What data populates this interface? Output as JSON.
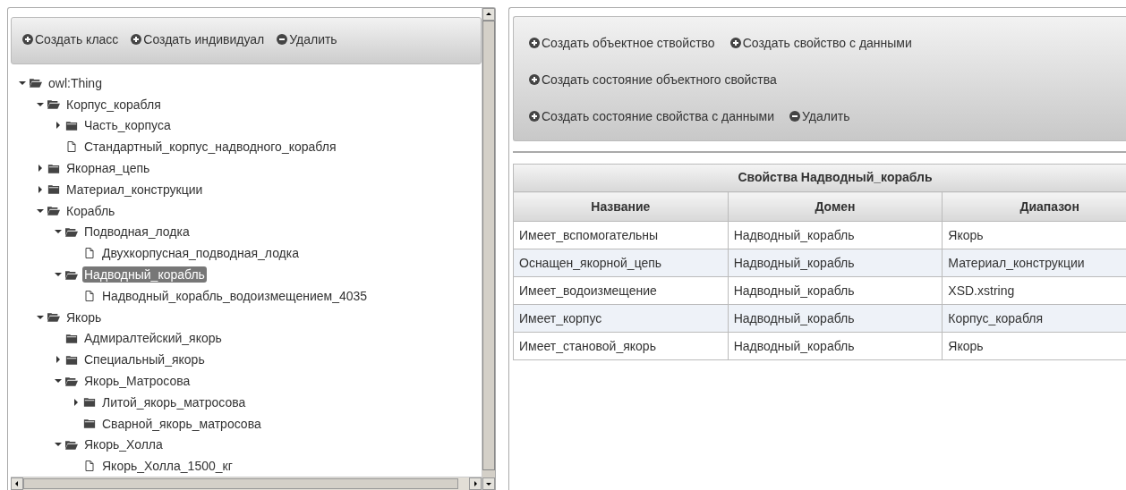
{
  "class_toolbar": [
    {
      "kind": "add",
      "label": "Создать класс"
    },
    {
      "kind": "add",
      "label": "Создать индивидуал"
    },
    {
      "kind": "remove",
      "label": "Удалить"
    }
  ],
  "tree": [
    {
      "label": "owl:Thing",
      "kind": "class",
      "expanded": true,
      "selected": false,
      "children": [
        {
          "label": "Корпус_корабля",
          "kind": "class",
          "expanded": true,
          "selected": false,
          "children": [
            {
              "label": "Часть_корпуса",
              "kind": "class",
              "expanded": false,
              "selected": false
            },
            {
              "label": "Стандартный_корпус_надводного_корабля",
              "kind": "individual",
              "selected": false
            }
          ]
        },
        {
          "label": "Якорная_цепь",
          "kind": "class",
          "expanded": false,
          "selected": false
        },
        {
          "label": "Материал_конструкции",
          "kind": "class",
          "expanded": false,
          "selected": false
        },
        {
          "label": "Корабль",
          "kind": "class",
          "expanded": true,
          "selected": false,
          "children": [
            {
              "label": "Подводная_лодка",
              "kind": "class",
              "expanded": true,
              "selected": false,
              "children": [
                {
                  "label": "Двухкорпусная_подводная_лодка",
                  "kind": "individual",
                  "selected": false
                }
              ]
            },
            {
              "label": "Надводный_корабль",
              "kind": "class",
              "expanded": true,
              "selected": true,
              "children": [
                {
                  "label": "Надводный_корабль_водоизмещением_4035",
                  "kind": "individual",
                  "selected": false
                }
              ]
            }
          ]
        },
        {
          "label": "Якорь",
          "kind": "class",
          "expanded": true,
          "selected": false,
          "children": [
            {
              "label": "Адмиралтейский_якорь",
              "kind": "class",
              "selected": false
            },
            {
              "label": "Специальный_якорь",
              "kind": "class",
              "expanded": false,
              "selected": false
            },
            {
              "label": "Якорь_Матросова",
              "kind": "class",
              "expanded": true,
              "selected": false,
              "children": [
                {
                  "label": "Литой_якорь_матросова",
                  "kind": "class",
                  "expanded": false,
                  "selected": false
                },
                {
                  "label": "Сварной_якорь_матросова",
                  "kind": "class",
                  "selected": false
                }
              ]
            },
            {
              "label": "Якорь_Холла",
              "kind": "class",
              "expanded": true,
              "selected": false,
              "children": [
                {
                  "label": "Якорь_Холла_1500_кг",
                  "kind": "individual",
                  "selected": false
                }
              ]
            }
          ]
        }
      ]
    }
  ],
  "property_toolbar": [
    [
      {
        "kind": "add",
        "label": "Создать объектное ствойство"
      },
      {
        "kind": "add",
        "label": "Создать свойство с данными"
      }
    ],
    [
      {
        "kind": "add",
        "label": "Создать состояние объектного свойства"
      }
    ],
    [
      {
        "kind": "add",
        "label": "Создать состояние свойства с данными"
      },
      {
        "kind": "remove",
        "label": "Удалить"
      }
    ]
  ],
  "table": {
    "title": "Свойства Надводный_корабль",
    "columns": [
      "Название",
      "Домен",
      "Диапазон"
    ],
    "rows": [
      [
        "Имеет_вспомогательны",
        "Надводный_корабль",
        "Якорь"
      ],
      [
        "Оснащен_якорной_цепь",
        "Надводный_корабль",
        "Материал_конструкции"
      ],
      [
        "Имеет_водоизмещение",
        "Надводный_корабль",
        "XSD.xstring"
      ],
      [
        "Имеет_корпус",
        "Надводный_корабль",
        "Корпус_корабля"
      ],
      [
        "Имеет_становой_якорь",
        "Надводный_корабль",
        "Якорь"
      ]
    ]
  }
}
